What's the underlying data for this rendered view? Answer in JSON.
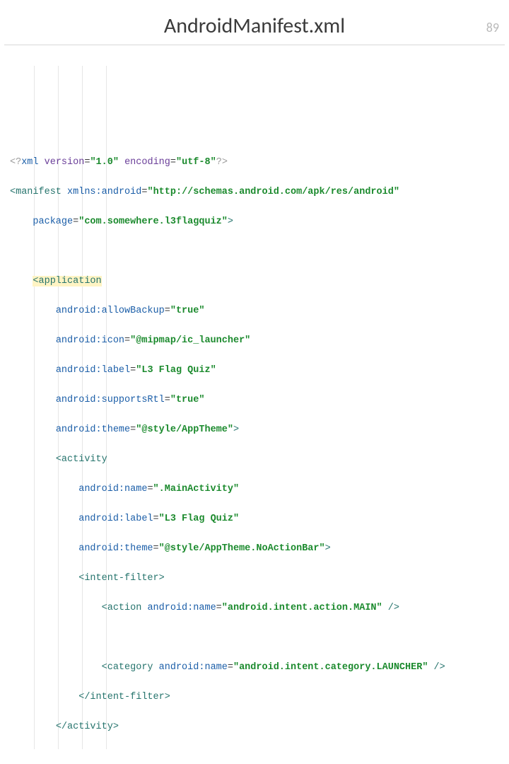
{
  "slide_number": "89",
  "title": "AndroidManifest.xml",
  "xml": {
    "decl": {
      "open": "<?",
      "name": "xml",
      "version_k": "version",
      "version_v": "\"1.0\"",
      "enc_k": "encoding",
      "enc_v": "\"utf-8\"",
      "close": "?>"
    },
    "manifest": {
      "open": "<manifest",
      "xmlns_k": "xmlns:android",
      "xmlns_v": "\"http://schemas.android.com/apk/res/android\"",
      "package_k": "package",
      "package_v": "\"com.somewhere.l3flagquiz\"",
      "close": ">"
    },
    "application": {
      "open": "<application",
      "allowBackup_k": "android:allowBackup",
      "allowBackup_v": "\"true\"",
      "icon_k": "android:icon",
      "icon_v": "\"@mipmap/ic_launcher\"",
      "label_k": "android:label",
      "label_v": "\"L3 Flag Quiz\"",
      "supportsRtl_k": "android:supportsRtl",
      "supportsRtl_v": "\"true\"",
      "theme_k": "android:theme",
      "theme_v": "\"@style/AppTheme\"",
      "close": ">"
    },
    "activity": {
      "open": "<activity",
      "name_k": "android:name",
      "name_v": "\".MainActivity\"",
      "label_k": "android:label",
      "label_v": "\"L3 Flag Quiz\"",
      "theme_k": "android:theme",
      "theme_v": "\"@style/AppTheme.NoActionBar\"",
      "close": ">",
      "end": "</activity>"
    },
    "intent_filter": {
      "open": "<intent-filter>",
      "end": "</intent-filter>"
    },
    "action": {
      "open": "<action",
      "name_k": "android:name",
      "name_v": "\"android.intent.action.MAIN\"",
      "close": " />"
    },
    "category": {
      "open": "<category",
      "name_k": "android:name",
      "name_v": "\"android.intent.category.LAUNCHER\"",
      "close": " />"
    }
  }
}
